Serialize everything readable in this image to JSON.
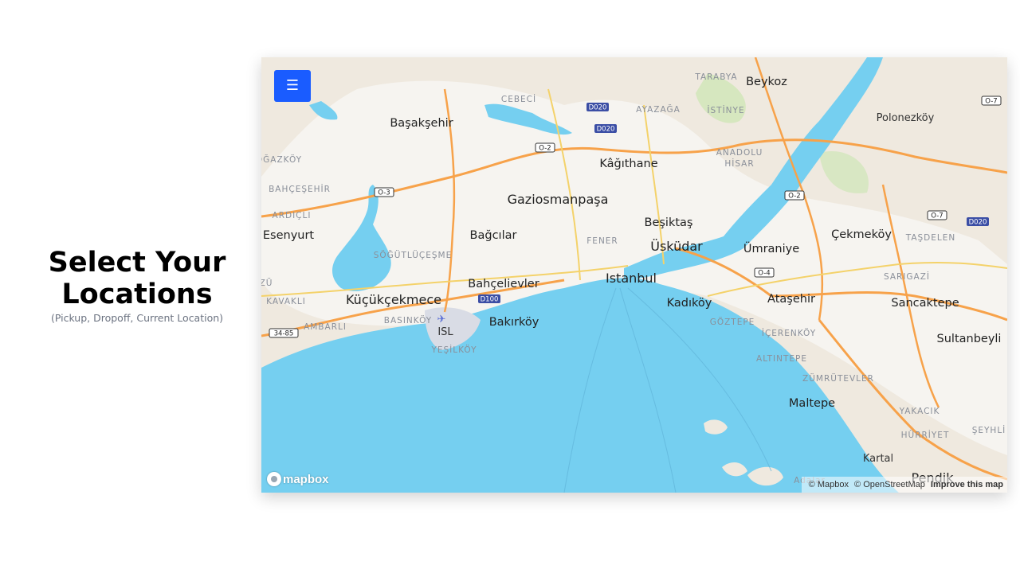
{
  "heading": {
    "title": "Select Your Locations",
    "subtitle": "(Pickup, Dropoff, Current Location)"
  },
  "menu_button": {
    "label": "☰"
  },
  "map": {
    "colors": {
      "land": "#efe9df",
      "water": "#75cff0",
      "urban": "#f6f4f0",
      "park": "#cfe6b7",
      "highway": "#f7a24a",
      "major_road": "#f4d26a",
      "airport": "#d9dce5",
      "accent_button": "#1a5cff"
    },
    "places": [
      {
        "name": "Beykoz",
        "size": "mid"
      },
      {
        "name": "Başakşehir",
        "size": "mid"
      },
      {
        "name": "Polonezköy",
        "size": "small"
      },
      {
        "name": "Kâğıthane",
        "size": "mid"
      },
      {
        "name": "Gaziosmanpaşa",
        "size": "big"
      },
      {
        "name": "Esenyurt",
        "size": "mid"
      },
      {
        "name": "Bağcılar",
        "size": "mid"
      },
      {
        "name": "Beşiktaş",
        "size": "mid"
      },
      {
        "name": "Üsküdar",
        "size": "big"
      },
      {
        "name": "Ümraniye",
        "size": "mid"
      },
      {
        "name": "Çekmeköy",
        "size": "mid"
      },
      {
        "name": "Bahçelievler",
        "size": "mid"
      },
      {
        "name": "Istanbul",
        "size": "big"
      },
      {
        "name": "Küçükçekmece",
        "size": "big"
      },
      {
        "name": "Kadıköy",
        "size": "mid"
      },
      {
        "name": "Ataşehir",
        "size": "mid"
      },
      {
        "name": "Sancaktepe",
        "size": "mid"
      },
      {
        "name": "Bakırköy",
        "size": "mid"
      },
      {
        "name": "Sultanbeyli",
        "size": "mid"
      },
      {
        "name": "Maltepe",
        "size": "mid"
      },
      {
        "name": "Kartal",
        "size": "small"
      },
      {
        "name": "Pendik",
        "size": "big"
      },
      {
        "name": "ISL",
        "size": "small"
      }
    ],
    "districts": [
      "TARABYA",
      "CEBECİ",
      "AYAZAĞA",
      "İSTİNYE",
      "ANADOLU",
      "HİSAR",
      "BAHÇEŞEHİR",
      "ARDIÇLI",
      "FENER",
      "SÖĞÜTLÜÇEŞME",
      "TAŞDELEN",
      "SARIGAZİ",
      "KAVAKLI",
      "AMBARLI",
      "BASINKÖY",
      "YEŞİLKÖY",
      "GÖZTEPE",
      "İÇERENKÖY",
      "ALTINTEPE",
      "ZÜMRÜTEVLER",
      "YAKACIK",
      "HÜRRİYET",
      "ŞEYHLİ",
      "OĞAZKÖY",
      "ZÜ",
      "Adalar"
    ],
    "road_shields": [
      {
        "label": "D020",
        "kind": "d"
      },
      {
        "label": "D020",
        "kind": "d"
      },
      {
        "label": "O-7",
        "kind": "o"
      },
      {
        "label": "O-2",
        "kind": "o"
      },
      {
        "label": "O-3",
        "kind": "o"
      },
      {
        "label": "O-2",
        "kind": "o"
      },
      {
        "label": "O-7",
        "kind": "o"
      },
      {
        "label": "D020",
        "kind": "d"
      },
      {
        "label": "O-4",
        "kind": "o"
      },
      {
        "label": "D100",
        "kind": "d"
      },
      {
        "label": "34-85",
        "kind": "o"
      }
    ]
  },
  "logo": {
    "text": "mapbox"
  },
  "attribution": {
    "mapbox": "© Mapbox",
    "osm": "© OpenStreetMap",
    "improve": "Improve this map"
  }
}
